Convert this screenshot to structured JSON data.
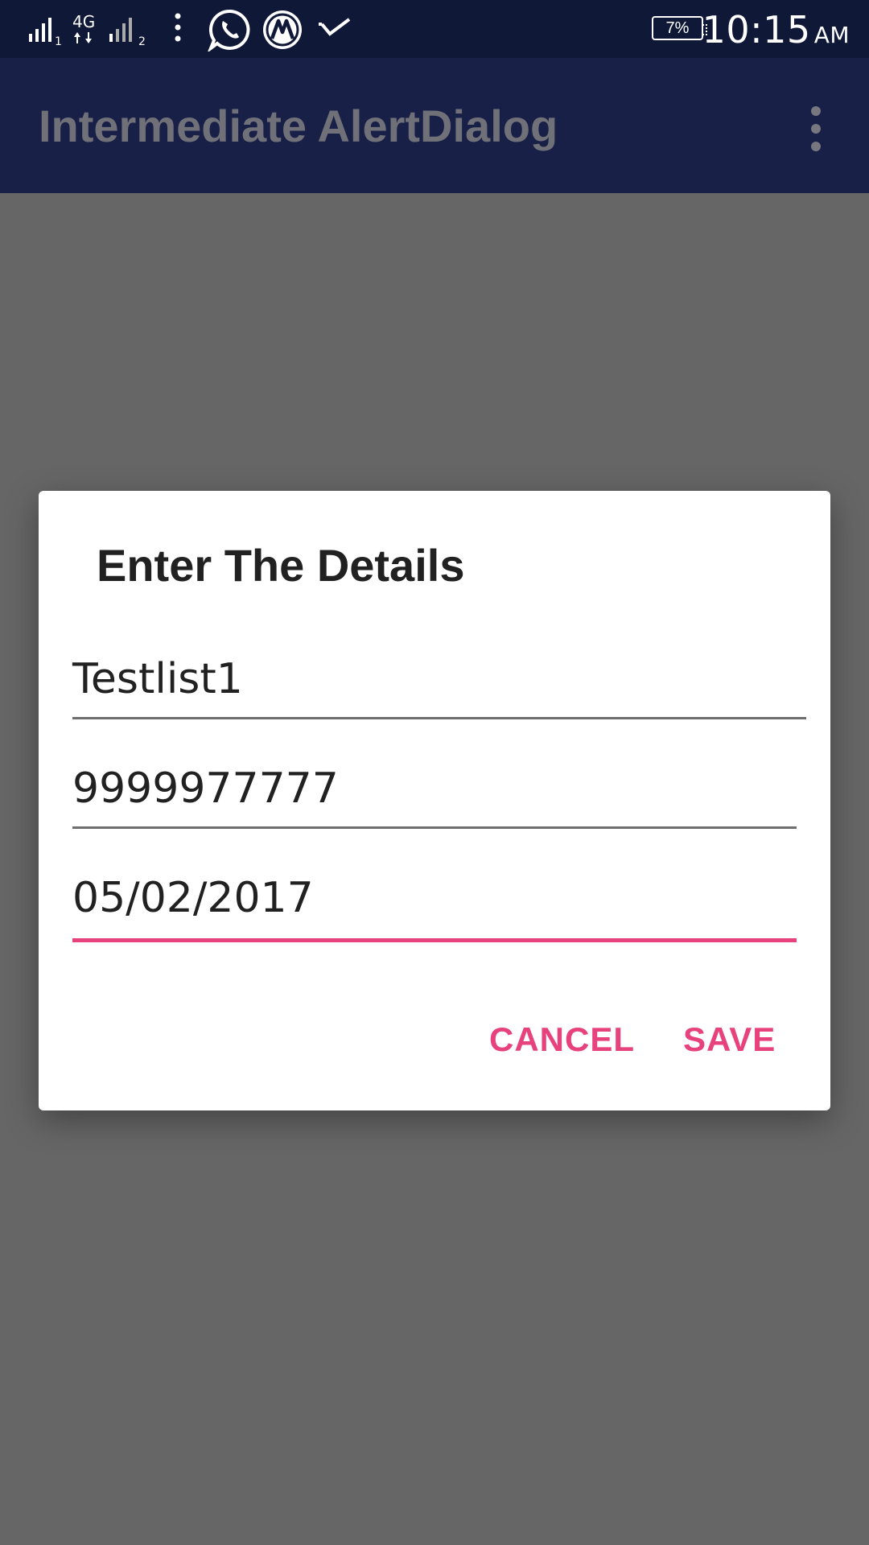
{
  "status_bar": {
    "network_type": "4G",
    "sim1_label": "1",
    "sim2_label": "2",
    "battery": "7%",
    "time": "10:15",
    "ampm": "AM",
    "icons": [
      "signal-icon",
      "4g-data-icon",
      "signal-sim2-icon",
      "more-notifications-icon",
      "whatsapp-icon",
      "m-app-icon",
      "check-icon",
      "battery-icon"
    ]
  },
  "app_bar": {
    "title": "Intermediate AlertDialog",
    "menu_icon": "overflow-menu-icon"
  },
  "dialog": {
    "title": "Enter The Details",
    "fields": [
      {
        "value": "Testlist1"
      },
      {
        "value": "9999977777"
      },
      {
        "value": "05/02/2017",
        "focused": true
      }
    ],
    "cancel_label": "CANCEL",
    "save_label": "SAVE"
  },
  "colors": {
    "status_bar": "#101838",
    "app_bar": "#182048",
    "scrim": "#666666",
    "accent": "#e8427c",
    "dialog_bg": "#ffffff"
  }
}
